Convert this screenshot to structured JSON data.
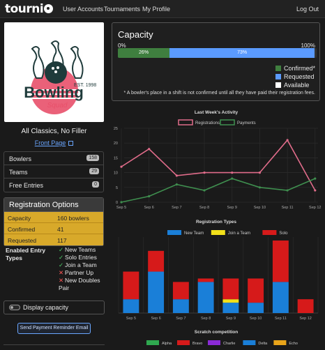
{
  "nav": {
    "brand": "tourni",
    "links": [
      "User Accounts",
      "Tournaments",
      "My Profile"
    ],
    "logout": "Log Out"
  },
  "logo": {
    "est": "EST. 1998",
    "name": "Bowling",
    "sub": "Squad"
  },
  "tournament": {
    "name": "All Classics, No Filler",
    "front_page": "Front Page"
  },
  "counts": [
    {
      "label": "Bowlers",
      "value": "158"
    },
    {
      "label": "Teams",
      "value": "29"
    },
    {
      "label": "Free Entries",
      "value": "0"
    }
  ],
  "registration": {
    "title": "Registration Options",
    "rows": [
      {
        "key": "Capacity",
        "value": "160 bowlers"
      },
      {
        "key": "Confirmed",
        "value": "41"
      },
      {
        "key": "Requested",
        "value": "117"
      }
    ],
    "types_label": "Enabled Entry Types",
    "types": [
      {
        "label": "New Teams",
        "enabled": true
      },
      {
        "label": "Solo Entries",
        "enabled": true
      },
      {
        "label": "Join a Team",
        "enabled": true
      },
      {
        "label": "Partner Up",
        "enabled": false
      },
      {
        "label": "New Doubles Pair",
        "enabled": false
      }
    ]
  },
  "display_capacity": "Display capacity",
  "send_reminder": "Send Payment Reminder Email",
  "capacity": {
    "title": "Capacity",
    "min_label": "0%",
    "max_label": "100%",
    "confirmed_label": "26%",
    "requested_label": "73%",
    "confirmed_pct": 26,
    "requested_pct": 73,
    "legend": [
      "Confirmed*",
      "Requested",
      "Available"
    ],
    "note": "* A bowler's place in a shift is not confirmed until all they have paid their registration fees.",
    "colors": {
      "confirmed": "#3f7f3f",
      "requested": "#5b9bff",
      "available": "#ffffff"
    }
  },
  "chart_data": [
    {
      "type": "line",
      "title": "Last Week's Activity",
      "categories": [
        "Sep 5",
        "Sep 6",
        "Sep 7",
        "Sep 8",
        "Sep 9",
        "Sep 10",
        "Sep 11",
        "Sep 12"
      ],
      "series": [
        {
          "name": "Registrations",
          "values": [
            12,
            18,
            9,
            10,
            10,
            10,
            21,
            4
          ],
          "color": "#e06c8a"
        },
        {
          "name": "Payments",
          "values": [
            0,
            2,
            6,
            4,
            8,
            5,
            4,
            8
          ],
          "color": "#3f8f4f"
        }
      ],
      "ylim": [
        0,
        25
      ],
      "yticks": [
        0,
        5,
        10,
        15,
        20,
        25
      ]
    },
    {
      "type": "bar",
      "stacked": true,
      "title": "Registration Types",
      "categories": [
        "Sep 5",
        "Sep 6",
        "Sep 7",
        "Sep 8",
        "Sep 9",
        "Sep 10",
        "Sep 11",
        "Sep 12"
      ],
      "series": [
        {
          "name": "New Team",
          "values": [
            4,
            12,
            4,
            9,
            3,
            3,
            9,
            0
          ],
          "color": "#1a7fd8"
        },
        {
          "name": "Join a Team",
          "values": [
            0,
            0,
            0,
            0,
            1,
            0,
            0,
            0
          ],
          "color": "#f2e01a"
        },
        {
          "name": "Solo",
          "values": [
            8,
            6,
            5,
            1,
            6,
            7,
            12,
            4
          ],
          "color": "#d61a1a"
        }
      ],
      "ylim": [
        0,
        22
      ]
    },
    {
      "type": "bar",
      "title": "Scratch competition",
      "legend": [
        {
          "name": "Alpha",
          "color": "#2fa84f"
        },
        {
          "name": "Bravo",
          "color": "#d61a1a"
        },
        {
          "name": "Charlie",
          "color": "#8a2ad6"
        },
        {
          "name": "Delta",
          "color": "#1a7fd8"
        },
        {
          "name": "Echo",
          "color": "#e8a41a"
        }
      ]
    }
  ]
}
